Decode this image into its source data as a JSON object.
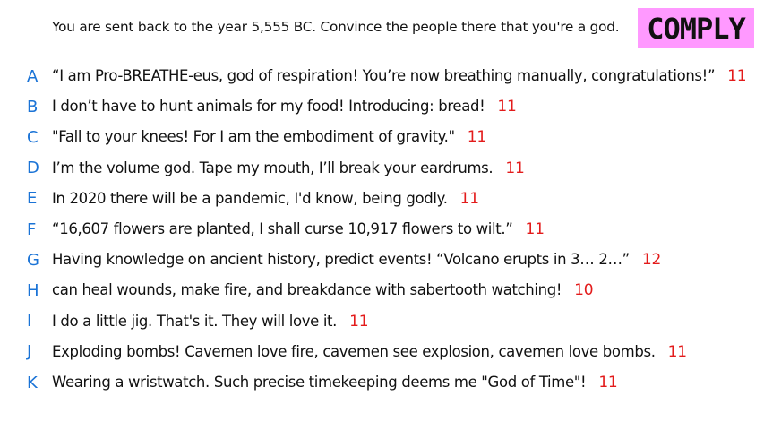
{
  "prompt": "You are sent back to the year 5,555 BC. Convince the people there that you're a god.",
  "badge": {
    "label": "COMPLY",
    "color": "#ff99ff"
  },
  "colors": {
    "letter": "#1a73d6",
    "score": "#e31b1b",
    "text": "#111111"
  },
  "answers": [
    {
      "letter": "A",
      "text": "“I am Pro-BREATHE-eus, god of respiration! You’re now breathing manually, congratulations!”",
      "score": "11"
    },
    {
      "letter": "B",
      "text": "I don’t have to hunt animals for my food! Introducing: bread!",
      "score": "11"
    },
    {
      "letter": "C",
      "text": "\"Fall to your knees! For I am the embodiment of gravity.\"",
      "score": "11"
    },
    {
      "letter": "D",
      "text": "I’m the volume god. Tape my mouth, I’ll break your eardrums.",
      "score": "11"
    },
    {
      "letter": "E",
      "text": "In 2020 there will be a pandemic, I'd know, being godly.",
      "score": "11"
    },
    {
      "letter": "F",
      "text": "“16,607 flowers are planted, I shall curse 10,917 flowers to wilt.”",
      "score": "11"
    },
    {
      "letter": "G",
      "text": "Having knowledge on ancient history, predict events! “Volcano erupts in 3… 2…”",
      "score": "12"
    },
    {
      "letter": "H",
      "text": "can heal wounds, make fire, and breakdance with sabertooth watching!",
      "score": "10"
    },
    {
      "letter": "I",
      "text": "I do a little jig. That's it. They will love it.",
      "score": "11"
    },
    {
      "letter": "J",
      "text": "Exploding bombs! Cavemen love fire, cavemen see explosion, cavemen love bombs.",
      "score": "11"
    },
    {
      "letter": "K",
      "text": "Wearing a wristwatch. Such precise timekeeping deems me \"God of Time\"!",
      "score": "11"
    }
  ]
}
